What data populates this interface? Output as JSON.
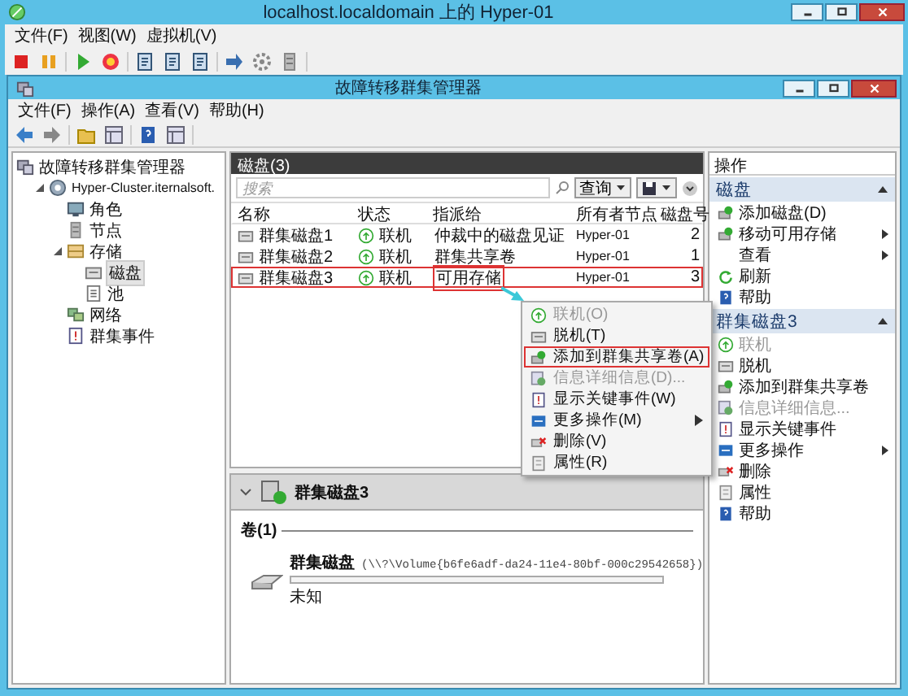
{
  "host_window": {
    "title": "localhost.localdomain 上的 Hyper-01",
    "menu": [
      "文件(F)",
      "视图(W)",
      "虚拟机(V)"
    ]
  },
  "app_window": {
    "title": "故障转移群集管理器",
    "menu": [
      "文件(F)",
      "操作(A)",
      "查看(V)",
      "帮助(H)"
    ]
  },
  "tree": {
    "root": "故障转移群集管理器",
    "items": [
      {
        "label": "Hyper-Cluster.iternalsoft.",
        "expanded": true,
        "selected": false,
        "children": [
          {
            "label": "角色",
            "selected": false
          },
          {
            "label": "节点",
            "selected": false
          },
          {
            "label": "存储",
            "expanded": true,
            "selected": false,
            "children": [
              {
                "label": "磁盘",
                "selected": true
              },
              {
                "label": "池",
                "selected": false
              }
            ]
          },
          {
            "label": "网络",
            "selected": false
          },
          {
            "label": "群集事件",
            "selected": false
          }
        ]
      }
    ]
  },
  "disks": {
    "title": "磁盘(3)",
    "search_placeholder": "搜索",
    "query_button": "查询",
    "columns": [
      "名称",
      "状态",
      "指派给",
      "所有者节点",
      "磁盘号"
    ],
    "rows": [
      {
        "name": "群集磁盘1",
        "status": "联机",
        "assigned_to": "仲裁中的磁盘见证",
        "owner": "Hyper-01",
        "disk_number": "2",
        "selected": false,
        "cell_marked": false
      },
      {
        "name": "群集磁盘2",
        "status": "联机",
        "assigned_to": "群集共享卷",
        "owner": "Hyper-01",
        "disk_number": "1",
        "selected": false,
        "cell_marked": false
      },
      {
        "name": "群集磁盘3",
        "status": "联机",
        "assigned_to": "可用存储",
        "owner": "Hyper-01",
        "disk_number": "3",
        "selected": true,
        "cell_marked": true
      }
    ]
  },
  "context_menu": [
    {
      "label": "联机(O)",
      "disabled": true,
      "submenu": false,
      "marked": false
    },
    {
      "label": "脱机(T)",
      "disabled": false,
      "submenu": false,
      "marked": false
    },
    {
      "label": "添加到群集共享卷(A)",
      "disabled": false,
      "submenu": false,
      "marked": true
    },
    {
      "label": "信息详细信息(D)...",
      "disabled": true,
      "submenu": false,
      "marked": false
    },
    {
      "label": "显示关键事件(W)",
      "disabled": false,
      "submenu": false,
      "marked": false
    },
    {
      "label": "更多操作(M)",
      "disabled": false,
      "submenu": true,
      "marked": false
    },
    {
      "label": "删除(V)",
      "disabled": false,
      "submenu": false,
      "marked": false
    },
    {
      "label": "属性(R)",
      "disabled": false,
      "submenu": false,
      "marked": false
    }
  ],
  "details": {
    "title": "群集磁盘3",
    "expanded": true,
    "volumes_heading": "卷(1)",
    "volumes": [
      {
        "name": "群集磁盘",
        "path": "(\\\\?\\Volume{b6fe6adf-da24-11e4-80bf-000c29542658})",
        "level": 0,
        "capacity": "未知"
      }
    ]
  },
  "actions": {
    "title": "操作",
    "sections": [
      {
        "title": "磁盘",
        "expanded": true,
        "items": [
          {
            "label": "添加磁盘(D)",
            "icon": true,
            "disabled": false,
            "submenu": false
          },
          {
            "label": "移动可用存储",
            "icon": true,
            "disabled": false,
            "submenu": true
          },
          {
            "label": "查看",
            "icon": false,
            "disabled": false,
            "submenu": true
          },
          {
            "label": "刷新",
            "icon": true,
            "disabled": false,
            "submenu": false
          },
          {
            "label": "帮助",
            "icon": true,
            "disabled": false,
            "submenu": false
          }
        ]
      },
      {
        "title": "群集磁盘3",
        "expanded": true,
        "items": [
          {
            "label": "联机",
            "icon": true,
            "disabled": true,
            "submenu": false
          },
          {
            "label": "脱机",
            "icon": true,
            "disabled": false,
            "submenu": false
          },
          {
            "label": "添加到群集共享卷",
            "icon": true,
            "disabled": false,
            "submenu": false
          },
          {
            "label": "信息详细信息...",
            "icon": true,
            "disabled": true,
            "submenu": false
          },
          {
            "label": "显示关键事件",
            "icon": true,
            "disabled": false,
            "submenu": false
          },
          {
            "label": "更多操作",
            "icon": true,
            "disabled": false,
            "submenu": true
          },
          {
            "label": "删除",
            "icon": true,
            "disabled": false,
            "submenu": false
          },
          {
            "label": "属性",
            "icon": true,
            "disabled": false,
            "submenu": false
          },
          {
            "label": "帮助",
            "icon": true,
            "disabled": false,
            "submenu": false
          }
        ]
      }
    ]
  }
}
